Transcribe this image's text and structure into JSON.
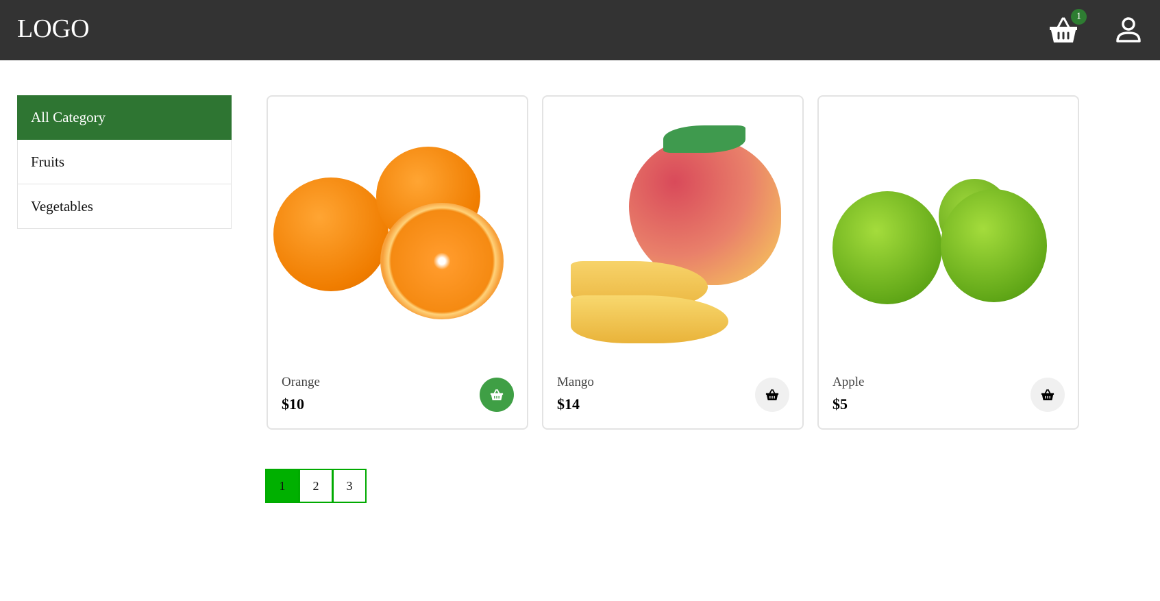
{
  "header": {
    "logo": "LOGO",
    "cart_count": "1"
  },
  "sidebar": {
    "items": [
      {
        "label": "All Category",
        "active": true
      },
      {
        "label": "Fruits"
      },
      {
        "label": "Vegetables"
      }
    ]
  },
  "products": [
    {
      "name": "Orange",
      "price": "$10",
      "in_cart": true
    },
    {
      "name": "Mango",
      "price": "$14",
      "in_cart": false
    },
    {
      "name": "Apple",
      "price": "$5",
      "in_cart": false
    }
  ],
  "pagination": {
    "pages": [
      "1",
      "2",
      "3"
    ],
    "current": "1"
  },
  "colors": {
    "header": "#333333",
    "accent": "#2e7532",
    "page_active": "#00b000",
    "cart_active": "#3f9f45"
  }
}
